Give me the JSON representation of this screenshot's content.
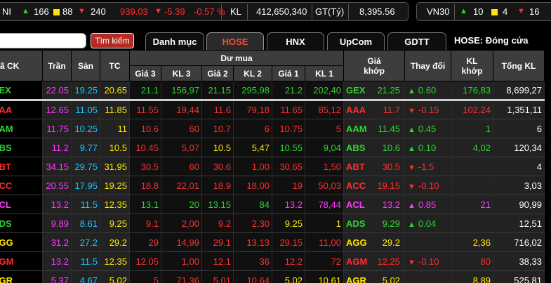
{
  "colors": {
    "ceiling": "#ff37ff",
    "floor": "#19c8ff",
    "reference": "#ffe600",
    "up": "#2dd62d",
    "down": "#ff2e2e",
    "search_button": "#b32b22",
    "active_tab_text": "#ff4a3a"
  },
  "index_bar": {
    "hnx_name": "NI",
    "hnx_up_icon": "triangle-up-icon",
    "hnx_up_count": "166",
    "hnx_unchanged_icon": "square-icon",
    "hnx_unchanged_count": "88",
    "hnx_down_icon": "triangle-down-icon",
    "hnx_down_count": "240",
    "hnx_value": "939.03",
    "hnx_change": "-5.39",
    "hnx_change_pct": "-0.57 %",
    "volume_label": "KL",
    "volume_value": "412,650,340",
    "value_label": "GT(Tỷ)",
    "value_value": "8,395.56",
    "vn30_name": "VN30",
    "vn30_up_count": "10",
    "vn30_unchanged_count": "4",
    "vn30_down_count": "16"
  },
  "toolbar": {
    "search_value": "",
    "search_button": "Tìm kiếm",
    "tabs": [
      "Danh mục",
      "HOSE",
      "HNX",
      "UpCom",
      "GDTT"
    ],
    "active_tab": "HOSE",
    "market_status": "HOSE:  Đóng cửa"
  },
  "table": {
    "headers": {
      "symbol": "ã CK",
      "ceiling": "Trần",
      "floor": "Sàn",
      "reference": "TC",
      "bid_group": "Dư mua",
      "bid_price3": "Giá 3",
      "bid_vol3": "KL 3",
      "bid_price2": "Giá 2",
      "bid_vol2": "KL 2",
      "bid_price1": "Giá 1",
      "bid_vol1": "KL 1",
      "match_price": "Giá khớp",
      "change": "Thay đổi",
      "match_vol": "KL khớp",
      "total_vol": "Tổng KL"
    },
    "rows": [
      {
        "sym_display": "EX",
        "ceiling": "22.05",
        "floor": "19.25",
        "ref": "20.65",
        "p3": "21.1",
        "v3": "156,97",
        "p2": "21.15",
        "v2": "295,98",
        "p1": "21.2",
        "v1": "202,40",
        "match_sym": "GEX",
        "match_price": "21.25",
        "change_dir": "up",
        "change": "0.60",
        "match_vol": "176,83",
        "total": "8,699,27"
      },
      {
        "sym_display": "AA",
        "ceiling": "12.65",
        "floor": "11.05",
        "ref": "11.85",
        "p3": "11.55",
        "v3": "19,44",
        "p2": "11.6",
        "v2": "79,18",
        "p1": "11.65",
        "v1": "85,12",
        "match_sym": "AAA",
        "match_price": "11.7",
        "change_dir": "down",
        "change": "-0.15",
        "match_vol": "102,24",
        "total": "1,351,11"
      },
      {
        "sym_display": "AM",
        "ceiling": "11.75",
        "floor": "10.25",
        "ref": "11",
        "p3": "10.6",
        "v3": "60",
        "p2": "10.7",
        "v2": "6",
        "p1": "10.75",
        "v1": "5",
        "match_sym": "AAM",
        "match_price": "11.45",
        "change_dir": "up",
        "change": "0.45",
        "match_vol": "1",
        "total": "6"
      },
      {
        "sym_display": "BS",
        "ceiling": "11.2",
        "floor": "9.77",
        "ref": "10.5",
        "p3": "10.45",
        "v3": "5,07",
        "p2": "10.5",
        "v2": "5,47",
        "p1": "10.55",
        "v1": "9,04",
        "match_sym": "ABS",
        "match_price": "10.6",
        "change_dir": "up",
        "change": "0.10",
        "match_vol": "4,02",
        "total": "120,34"
      },
      {
        "sym_display": "BT",
        "ceiling": "34.15",
        "floor": "29.75",
        "ref": "31.95",
        "p3": "30.5",
        "v3": "60",
        "p2": "30.6",
        "v2": "1,00",
        "p1": "30.65",
        "v1": "1,50",
        "match_sym": "ABT",
        "match_price": "30.5",
        "change_dir": "down",
        "change": "-1.5",
        "match_vol": "",
        "total": "4"
      },
      {
        "sym_display": "CC",
        "ceiling": "20.55",
        "floor": "17.95",
        "ref": "19.25",
        "p3": "18.8",
        "v3": "22,01",
        "p2": "18.9",
        "v2": "18,00",
        "p1": "19",
        "v1": "50,03",
        "match_sym": "ACC",
        "match_price": "19.15",
        "change_dir": "down",
        "change": "-0.10",
        "match_vol": "",
        "total": "3,03"
      },
      {
        "sym_display": "CL",
        "ceiling": "13.2",
        "floor": "11.5",
        "ref": "12.35",
        "p3": "13.1",
        "v3": "20",
        "p2": "13.15",
        "v2": "84",
        "p1": "13.2",
        "v1": "78,44",
        "match_sym": "ACL",
        "match_price": "13.2",
        "change_dir": "ceil",
        "change": "0.85",
        "match_vol": "21",
        "total": "90,99"
      },
      {
        "sym_display": "DS",
        "ceiling": "9.89",
        "floor": "8.61",
        "ref": "9.25",
        "p3": "9.1",
        "v3": "2,00",
        "p2": "9.2",
        "v2": "2,30",
        "p1": "9.25",
        "v1": "1",
        "match_sym": "ADS",
        "match_price": "9.29",
        "change_dir": "up",
        "change": "0.04",
        "match_vol": "",
        "total": "12,51"
      },
      {
        "sym_display": "GG",
        "ceiling": "31.2",
        "floor": "27.2",
        "ref": "29.2",
        "p3": "29",
        "v3": "14,99",
        "p2": "29.1",
        "v2": "13,13",
        "p1": "29.15",
        "v1": "11,00",
        "match_sym": "AGG",
        "match_price": "29.2",
        "change_dir": "ref",
        "change": "",
        "match_vol": "2,36",
        "total": "716,02"
      },
      {
        "sym_display": "GM",
        "ceiling": "13.2",
        "floor": "11.5",
        "ref": "12.35",
        "p3": "12.05",
        "v3": "1,00",
        "p2": "12.1",
        "v2": "36",
        "p1": "12.2",
        "v1": "72",
        "match_sym": "AGM",
        "match_price": "12.25",
        "change_dir": "down",
        "change": "-0.10",
        "match_vol": "80",
        "total": "38,33"
      },
      {
        "sym_display": "GR",
        "ceiling": "5.37",
        "floor": "4.67",
        "ref": "5.02",
        "p3": "5",
        "v3": "71,36",
        "p2": "5.01",
        "v2": "10,64",
        "p1": "5.02",
        "v1": "10,61",
        "match_sym": "AGR",
        "match_price": "5.02",
        "change_dir": "ref",
        "change": "",
        "match_vol": "8,89",
        "total": "525,81"
      }
    ]
  }
}
